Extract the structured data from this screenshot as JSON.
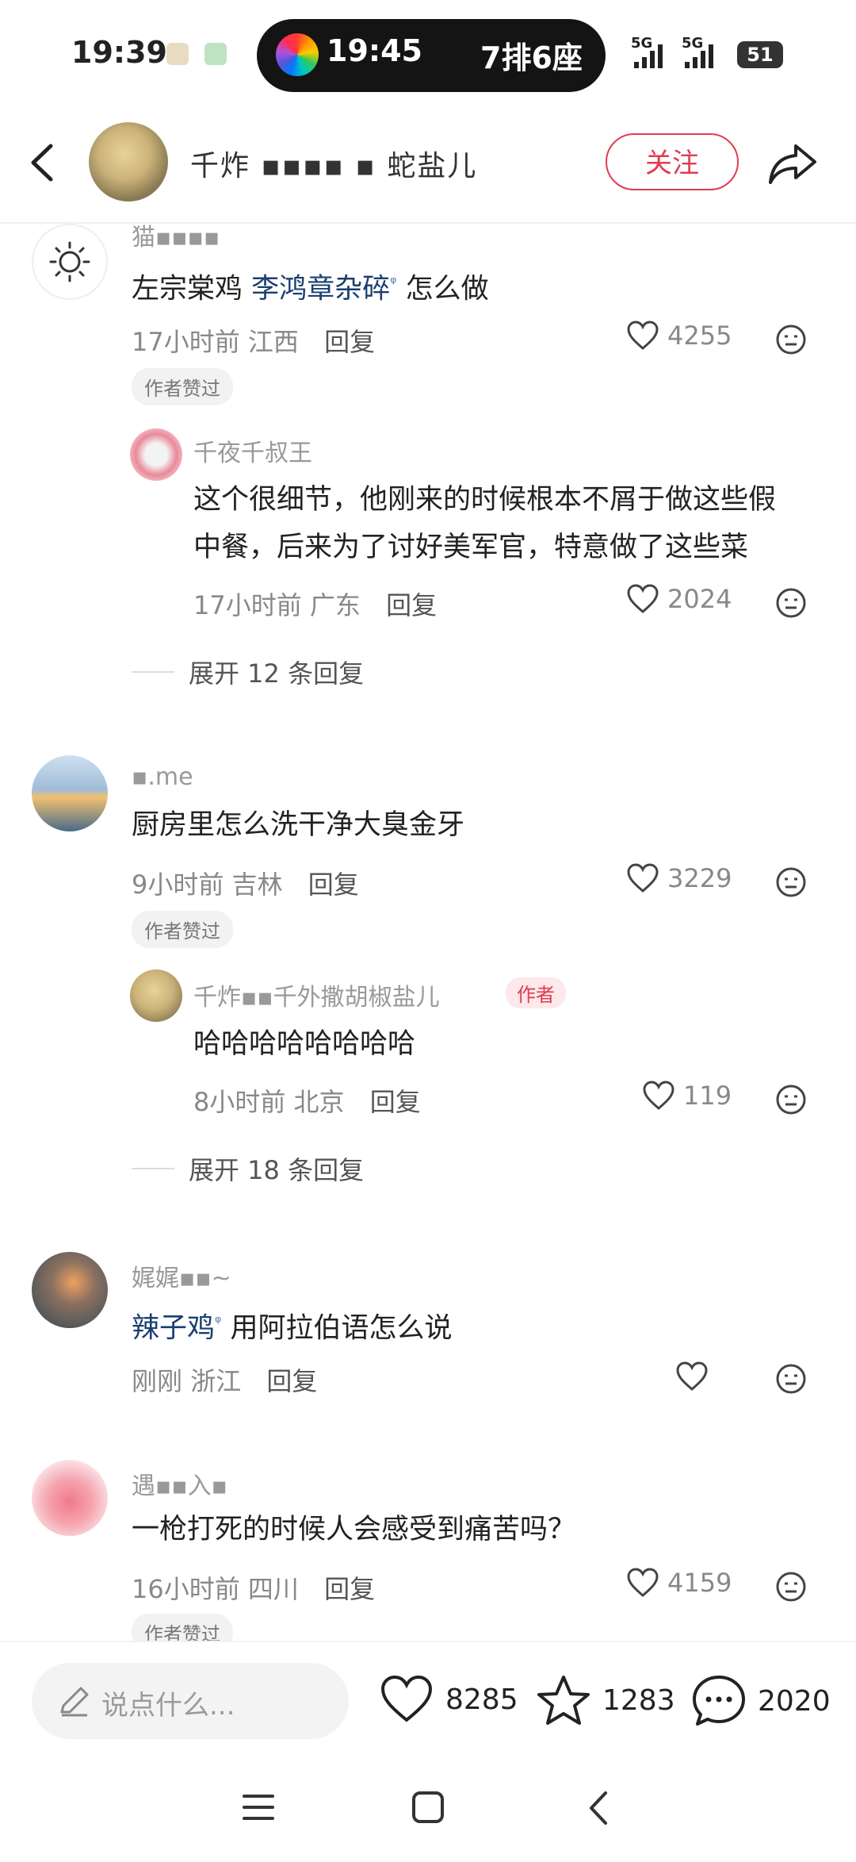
{
  "status_bar": {
    "time": "19:39",
    "pill_time": "19:45",
    "pill_text": "7排6座",
    "network1": "5G",
    "network2": "5G",
    "battery": "51"
  },
  "header": {
    "title": "千炸 ▪▪▪▪ ▪ 蛇盐儿",
    "follow_label": "关注"
  },
  "comments": [
    {
      "name": "猫▪▪▪▪",
      "text_link": "李鸿章杂碎",
      "text_prefix": "左宗棠鸡 ",
      "text_suffix": " 怎么做",
      "time": "17小时前",
      "location": "江西",
      "reply_label": "回复",
      "likes": "4255",
      "badge": "作者赞过",
      "reply": {
        "name": "千夜千叔王",
        "text_line1": "这个很细节，他刚来的时候根本不屑于做这些假",
        "text_line2": "中餐，后来为了讨好美军官，特意做了这些菜",
        "time": "17小时前",
        "location": "广东",
        "reply_label": "回复",
        "likes": "2024"
      },
      "expand": "展开 12 条回复"
    },
    {
      "name": "▪.me",
      "text": "厨房里怎么洗干净大臭金牙",
      "time": "9小时前",
      "location": "吉林",
      "reply_label": "回复",
      "likes": "3229",
      "badge": "作者赞过",
      "reply": {
        "name": "千炸▪▪千外撒胡椒盐儿",
        "author_badge": "作者",
        "text": "哈哈哈哈哈哈哈哈",
        "time": "8小时前",
        "location": "北京",
        "reply_label": "回复",
        "likes": "119"
      },
      "expand": "展开 18 条回复"
    },
    {
      "name": "娓娓▪▪~",
      "text_link": "辣子鸡",
      "text_suffix": " 用阿拉伯语怎么说",
      "time": "刚刚",
      "location": "浙江",
      "reply_label": "回复"
    },
    {
      "name": "遇▪▪入▪",
      "text": "一枪打死的时候人会感受到痛苦吗？",
      "time": "16小时前",
      "location": "四川",
      "reply_label": "回复",
      "likes": "4159",
      "badge": "作者赞过"
    }
  ],
  "bottom_bar": {
    "input_placeholder": "说点什么...",
    "likes": "8285",
    "favorites": "1283",
    "comments": "2020"
  },
  "colors": {
    "accent": "#e03c50",
    "link": "#1a3f70"
  }
}
